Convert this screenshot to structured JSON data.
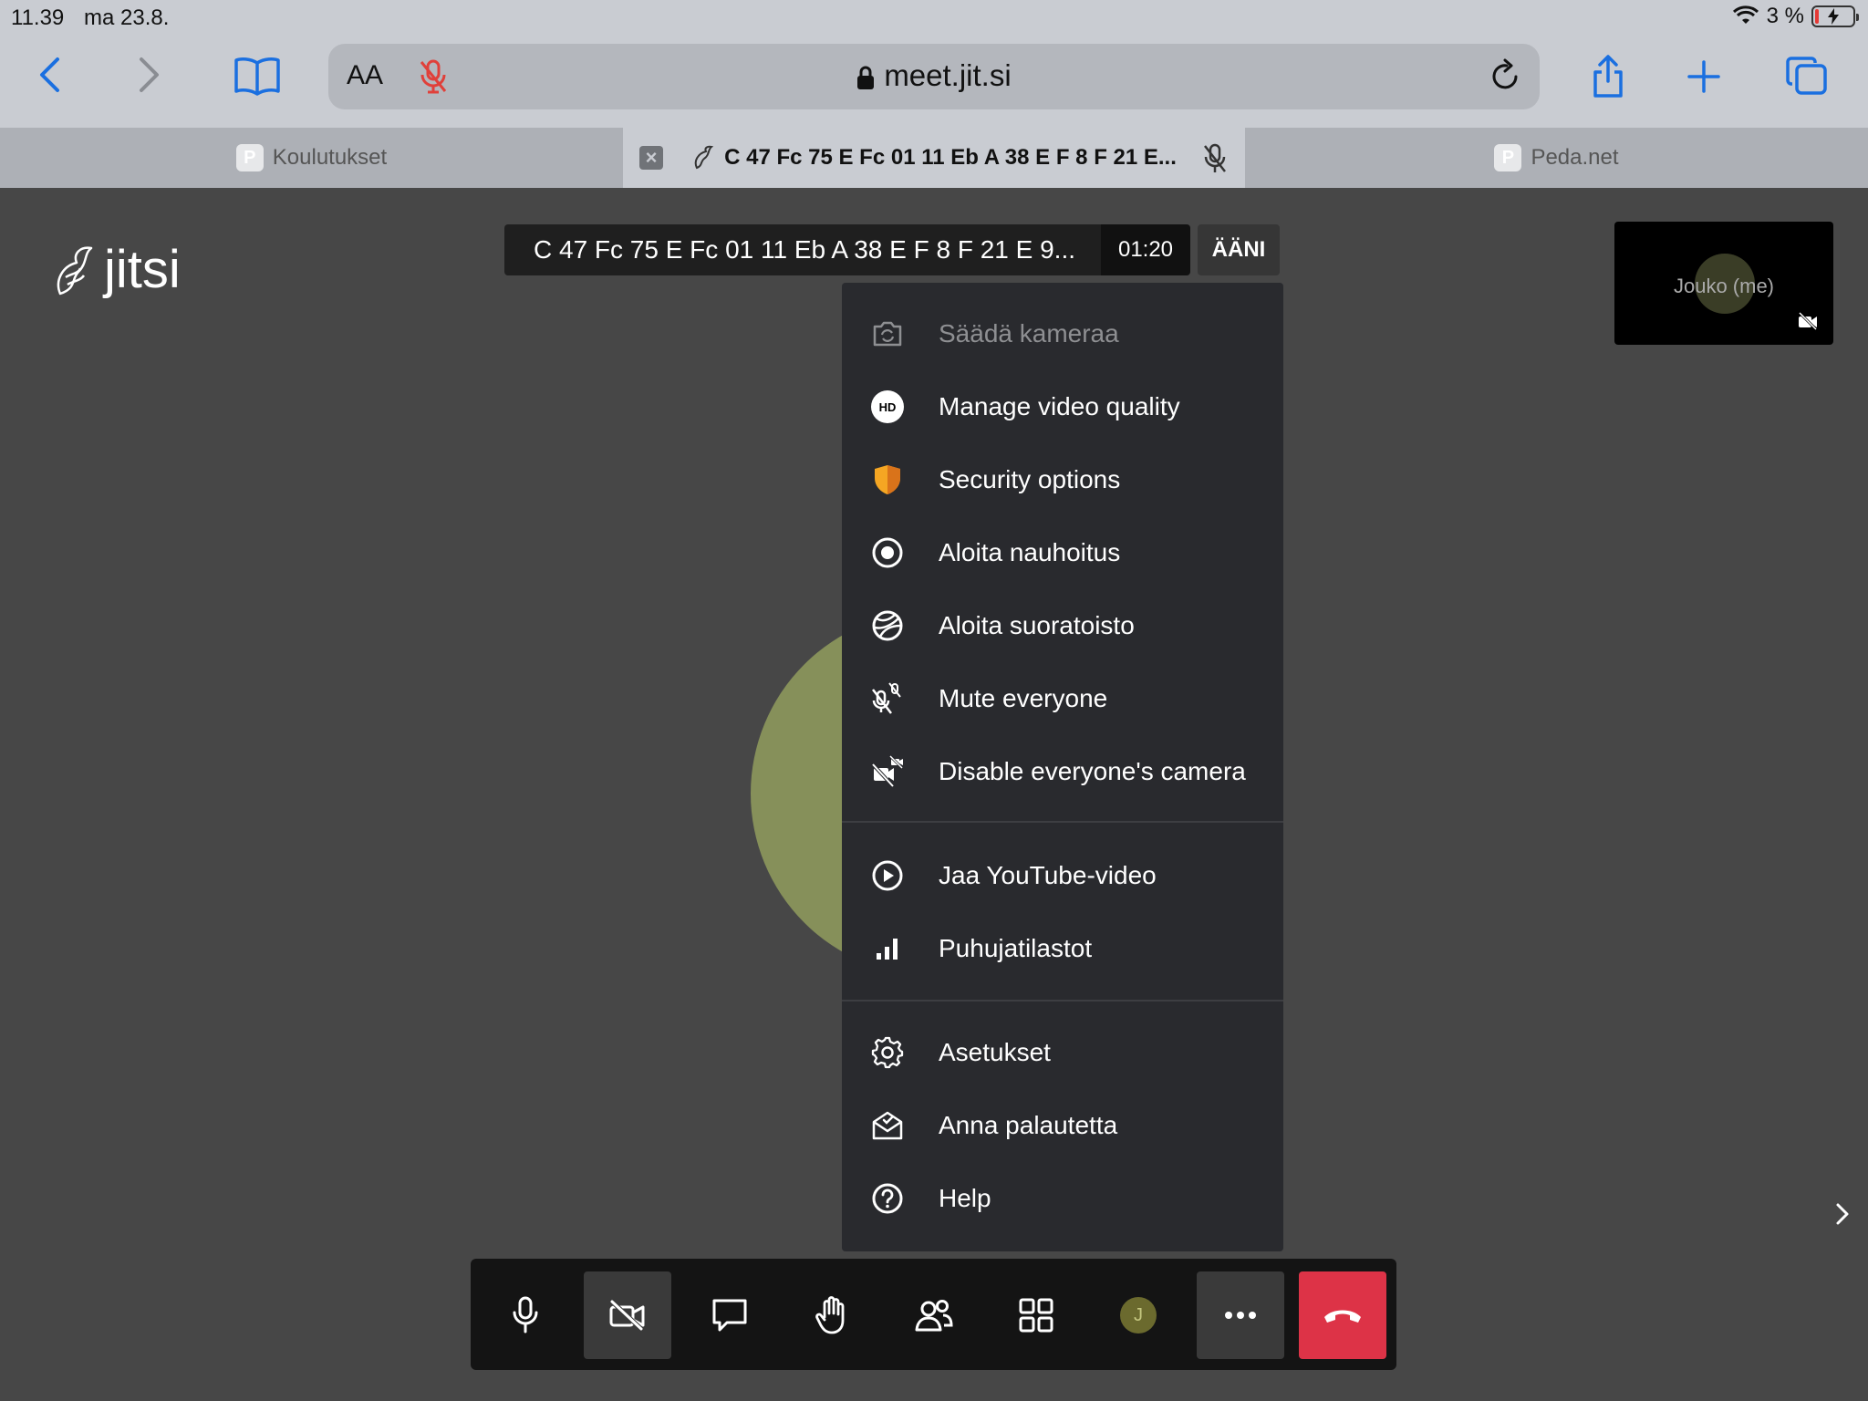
{
  "status_bar": {
    "time": "11.39",
    "date": "ma 23.8.",
    "battery": "3 %"
  },
  "browser": {
    "address_aa": "AA",
    "url": "meet.jit.si",
    "tabs": [
      {
        "label": "Koulutukset",
        "favicon": "P"
      },
      {
        "label": "C 47 Fc 75 E Fc 01 11 Eb A 38 E F 8 F 21 E..."
      },
      {
        "label": "Peda.net",
        "favicon": "P"
      }
    ]
  },
  "jitsi": {
    "logo_text": "jitsi",
    "subject": "C 47 Fc 75 E Fc 01 11 Eb A 38 E F 8 F 21 E 9...",
    "timer": "01:20",
    "audio_label": "ÄÄNI",
    "local_participant": "Jouko (me)",
    "toolbar_avatar_initial": "J"
  },
  "menu": {
    "hd_badge": "HD",
    "items": [
      {
        "label": "Säädä kameraa",
        "icon": "camera-flip-icon",
        "disabled": true
      },
      {
        "label": "Manage video quality",
        "icon": "hd-icon"
      },
      {
        "label": "Security options",
        "icon": "shield-icon"
      },
      {
        "label": "Aloita nauhoitus",
        "icon": "record-icon"
      },
      {
        "label": "Aloita suoratoisto",
        "icon": "livestream-icon"
      },
      {
        "label": "Mute everyone",
        "icon": "mute-everyone-icon"
      },
      {
        "label": "Disable everyone's camera",
        "icon": "disable-camera-icon"
      },
      {
        "label": "Jaa YouTube-video",
        "icon": "play-icon"
      },
      {
        "label": "Puhujatilastot",
        "icon": "stats-icon"
      },
      {
        "label": "Asetukset",
        "icon": "gear-icon"
      },
      {
        "label": "Anna palautetta",
        "icon": "feedback-icon"
      },
      {
        "label": "Help",
        "icon": "help-icon"
      }
    ]
  },
  "colors": {
    "hangup": "#dd3347",
    "shield": "#f5a623",
    "ios_blue": "#1a6fe0",
    "avatar": "#86905a"
  }
}
